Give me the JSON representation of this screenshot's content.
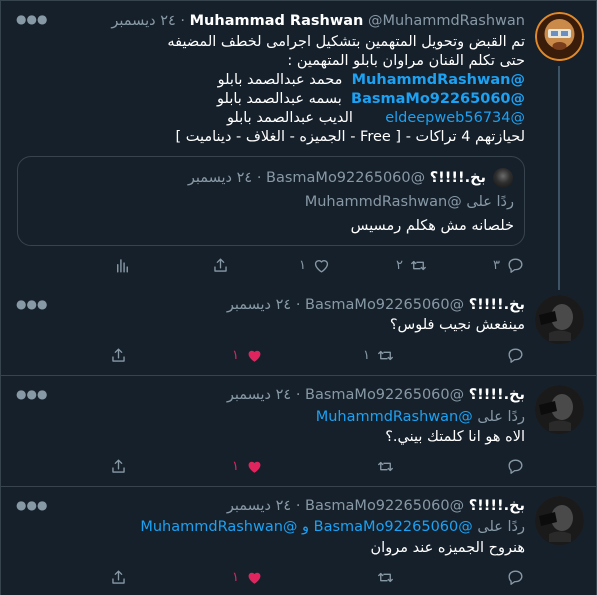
{
  "colors": {
    "background": "#15202b",
    "text": "#ffffff",
    "muted": "#8899a6",
    "link": "#1da1f2",
    "like": "#e0245e",
    "border": "#38444d"
  },
  "main_tweet": {
    "name": "Muhammad Rashwan",
    "handle": "@MuhammdRashwan",
    "dot": "·",
    "date": "٢٤ ديسمبر",
    "line1": "تم القبض وتحويل المتهمين بتشكيل اجرامى لخطف المضيفه",
    "line2": "حتى تكلم الفنان مراوان بابلو المتهمين :",
    "line3_mention": "@MuhammdRashwan",
    "line3_text": "محمد عبدالصمد بابلو",
    "line4_mention": "@BasmaMo92265060",
    "line4_text": "بسمه عبدالصمد بابلو",
    "line5_mention": "@eldeepweb56734",
    "line5_text": "الديب عبدالصمد بابلو",
    "line6": "لحيازتهم 4 تراكات - [ Free - الجميزه - الغلاف - ديناميت ]",
    "quote": {
      "name": "بخ.!!!!؟",
      "handle": "@BasmaMo92265060",
      "dot": "·",
      "date": "٢٤ ديسمبر",
      "reply_to": "ردًا على @MuhammdRashwan",
      "text": "خلصانه مش هكلم رمسيس"
    },
    "counts": {
      "reply": "٣",
      "retweet": "٢",
      "like": "١"
    }
  },
  "replies": [
    {
      "name": "بخ.!!!!؟",
      "handle": "@BasmaMo92265060",
      "dot": "·",
      "date": "٢٤ ديسمبر",
      "reply_prefix": "",
      "reply_handles": "",
      "text": "مينفعش نجيب فلوس؟",
      "counts": {
        "retweet": "١",
        "like": "١"
      }
    },
    {
      "name": "بخ.!!!!؟",
      "handle": "@BasmaMo92265060",
      "dot": "·",
      "date": "٢٤ ديسمبر",
      "reply_prefix": "ردًا على",
      "reply_handles": "@MuhammdRashwan",
      "text": "الاه هو انا كلمتك بيني.؟",
      "counts": {
        "retweet": "",
        "like": "١"
      }
    },
    {
      "name": "بخ.!!!!؟",
      "handle": "@BasmaMo92265060",
      "dot": "·",
      "date": "٢٤ ديسمبر",
      "reply_prefix": "ردًا على",
      "reply_handles": "@BasmaMo92265060 و @MuhammdRashwan",
      "text": "هنروح الجميزه عند مروان",
      "counts": {
        "retweet": "",
        "like": "١"
      }
    }
  ],
  "icons": {
    "more": "more-icon",
    "reply": "reply-icon",
    "retweet": "retweet-icon",
    "like": "heart-icon",
    "share": "share-icon",
    "analytics": "analytics-icon"
  }
}
